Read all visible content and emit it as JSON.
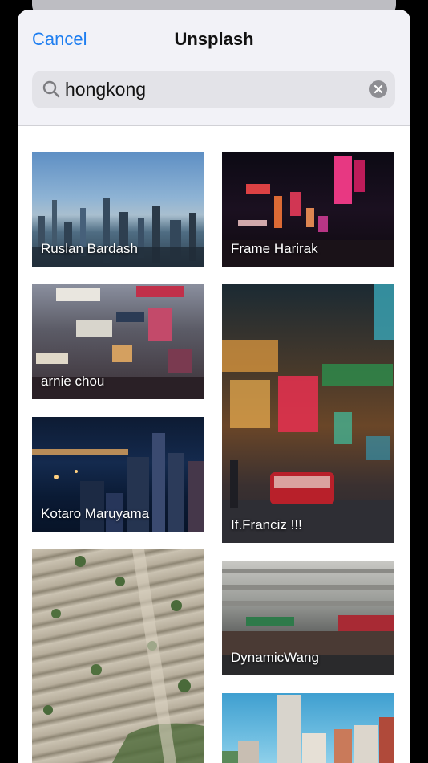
{
  "header": {
    "cancel_label": "Cancel",
    "title": "Unsplash"
  },
  "search": {
    "value": "hongkong",
    "search_icon": "magnifier-icon",
    "clear_icon": "clear-x-icon"
  },
  "photos": [
    {
      "author": "Ruslan Bardash"
    },
    {
      "author": "Frame Harirak"
    },
    {
      "author": "arnie chou"
    },
    {
      "author": "If.Franciz !!!"
    },
    {
      "author": "Kotaro Maruyama"
    },
    {
      "author": "DynamicWang"
    },
    {
      "author": ""
    },
    {
      "author": ""
    }
  ],
  "colors": {
    "accent": "#1e7ef0",
    "sheet_bg": "#f2f2f7",
    "search_bg": "#e3e3e8"
  }
}
